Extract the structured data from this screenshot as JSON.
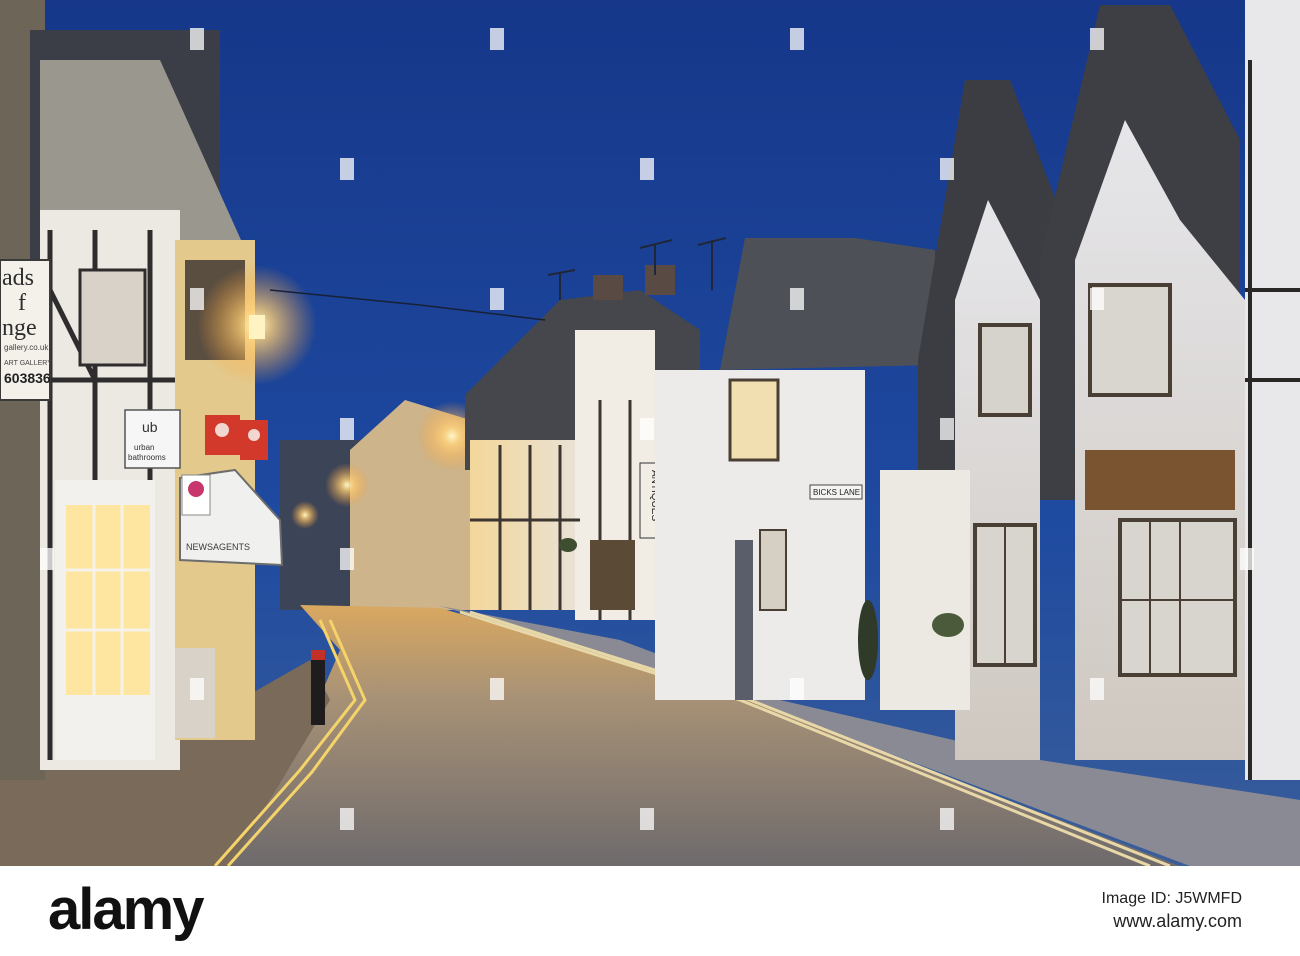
{
  "photo": {
    "scene_type": "village street at dusk",
    "colors": {
      "sky": "#1e4aa0",
      "lamp": "#ffd27a",
      "road": "#8c8684",
      "wall": "#f0ece4",
      "roof": "#3a3c42"
    }
  },
  "signs": {
    "gallery_line1": "ads",
    "gallery_line2": "f",
    "gallery_line3": "nge",
    "gallery_url": "gallery.co.uk",
    "gallery_sub": "ART GALLERY",
    "gallery_phone": "603836",
    "urban_logo": "ub",
    "urban_name1": "urban",
    "urban_name2": "bathrooms",
    "newsagent": "NEWSAGENTS",
    "antiques": "ANTIQUES",
    "lane": "BICKS LANE"
  },
  "footer": {
    "brand": "alamy",
    "stock_label": "Image ID: J5WMFD",
    "stock_url": "www.alamy.com"
  }
}
